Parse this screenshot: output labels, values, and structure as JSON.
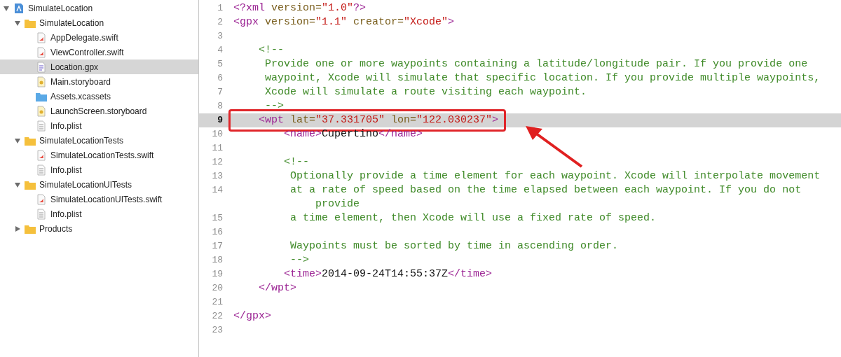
{
  "navigator": {
    "items": [
      {
        "label": "SimulateLocation",
        "kind": "project",
        "expanded": true,
        "selected": false,
        "children": [
          {
            "label": "SimulateLocation",
            "kind": "folder",
            "expanded": true,
            "selected": false,
            "children": [
              {
                "label": "AppDelegate.swift",
                "kind": "swift",
                "selected": false
              },
              {
                "label": "ViewController.swift",
                "kind": "swift",
                "selected": false
              },
              {
                "label": "Location.gpx",
                "kind": "gpx",
                "selected": true
              },
              {
                "label": "Main.storyboard",
                "kind": "storyboard",
                "selected": false
              },
              {
                "label": "Assets.xcassets",
                "kind": "assets",
                "selected": false
              },
              {
                "label": "LaunchScreen.storyboard",
                "kind": "storyboard",
                "selected": false
              },
              {
                "label": "Info.plist",
                "kind": "plist",
                "selected": false
              }
            ]
          },
          {
            "label": "SimulateLocationTests",
            "kind": "folder",
            "expanded": true,
            "selected": false,
            "children": [
              {
                "label": "SimulateLocationTests.swift",
                "kind": "swift",
                "selected": false
              },
              {
                "label": "Info.plist",
                "kind": "plist",
                "selected": false
              }
            ]
          },
          {
            "label": "SimulateLocationUITests",
            "kind": "folder",
            "expanded": true,
            "selected": false,
            "children": [
              {
                "label": "SimulateLocationUITests.swift",
                "kind": "swift",
                "selected": false
              },
              {
                "label": "Info.plist",
                "kind": "plist",
                "selected": false
              }
            ]
          },
          {
            "label": "Products",
            "kind": "folder",
            "expanded": false,
            "selected": false
          }
        ]
      }
    ]
  },
  "editor": {
    "lines": [
      {
        "number": "1",
        "current": false,
        "segments": [
          {
            "kind": "tag",
            "text": "<?xml "
          },
          {
            "kind": "attr",
            "text": "version="
          },
          {
            "kind": "string",
            "text": "\"1.0\""
          },
          {
            "kind": "tag",
            "text": "?>"
          }
        ]
      },
      {
        "number": "2",
        "current": false,
        "segments": [
          {
            "kind": "tag",
            "text": "<gpx "
          },
          {
            "kind": "attr",
            "text": "version="
          },
          {
            "kind": "string",
            "text": "\"1.1\""
          },
          {
            "kind": "attr",
            "text": " creator="
          },
          {
            "kind": "string",
            "text": "\"Xcode\""
          },
          {
            "kind": "tag",
            "text": ">"
          }
        ]
      },
      {
        "number": "3",
        "current": false
      },
      {
        "number": "4",
        "current": false,
        "segments": [
          {
            "kind": "comment",
            "text": "    <!--"
          }
        ]
      },
      {
        "number": "5",
        "current": false,
        "segments": [
          {
            "kind": "comment",
            "text": "     Provide one or more waypoints containing a latitude/longitude pair. If you provide one"
          }
        ]
      },
      {
        "number": "6",
        "current": false,
        "segments": [
          {
            "kind": "comment",
            "text": "     waypoint, Xcode will simulate that specific location. If you provide multiple waypoints,"
          }
        ]
      },
      {
        "number": "7",
        "current": false,
        "segments": [
          {
            "kind": "comment",
            "text": "     Xcode will simulate a route visiting each waypoint."
          }
        ]
      },
      {
        "number": "8",
        "current": false,
        "segments": [
          {
            "kind": "comment",
            "text": "     -->"
          }
        ]
      },
      {
        "number": "9",
        "current": true,
        "segments": [
          {
            "kind": "tag",
            "text": "    <wpt "
          },
          {
            "kind": "attr",
            "text": "lat="
          },
          {
            "kind": "string",
            "text": "\"37.331705\""
          },
          {
            "kind": "attr",
            "text": " lon="
          },
          {
            "kind": "string",
            "text": "\"122.030237\""
          },
          {
            "kind": "tag",
            "text": ">"
          }
        ]
      },
      {
        "number": "10",
        "current": false,
        "segments": [
          {
            "kind": "tag",
            "text": "        <name>"
          },
          {
            "kind": "text",
            "text": "Cupertino"
          },
          {
            "kind": "tag",
            "text": "</name>"
          }
        ]
      },
      {
        "number": "11",
        "current": false
      },
      {
        "number": "12",
        "current": false,
        "segments": [
          {
            "kind": "comment",
            "text": "        <!--"
          }
        ]
      },
      {
        "number": "13",
        "current": false,
        "segments": [
          {
            "kind": "comment",
            "text": "         Optionally provide a time element for each waypoint. Xcode will interpolate movement"
          }
        ]
      },
      {
        "number": "14",
        "current": false,
        "segments": [
          {
            "kind": "comment",
            "text": "         at a rate of speed based on the time elapsed between each waypoint. If you do not"
          }
        ],
        "continuation": [
          {
            "kind": "comment",
            "text": "             provide"
          }
        ]
      },
      {
        "number": "15",
        "current": false,
        "segments": [
          {
            "kind": "comment",
            "text": "         a time element, then Xcode will use a fixed rate of speed."
          }
        ]
      },
      {
        "number": "16",
        "current": false
      },
      {
        "number": "17",
        "current": false,
        "segments": [
          {
            "kind": "comment",
            "text": "         Waypoints must be sorted by time in ascending order."
          }
        ]
      },
      {
        "number": "18",
        "current": false,
        "segments": [
          {
            "kind": "comment",
            "text": "         -->"
          }
        ]
      },
      {
        "number": "19",
        "current": false,
        "segments": [
          {
            "kind": "tag",
            "text": "        <time>"
          },
          {
            "kind": "text",
            "text": "2014-09-24T14:55:37Z"
          },
          {
            "kind": "tag",
            "text": "</time>"
          }
        ]
      },
      {
        "number": "20",
        "current": false,
        "segments": [
          {
            "kind": "tag",
            "text": "    </wpt>"
          }
        ]
      },
      {
        "number": "21",
        "current": false
      },
      {
        "number": "22",
        "current": false,
        "segments": [
          {
            "kind": "tag",
            "text": "</gpx>"
          }
        ]
      },
      {
        "number": "23",
        "current": false
      }
    ]
  }
}
